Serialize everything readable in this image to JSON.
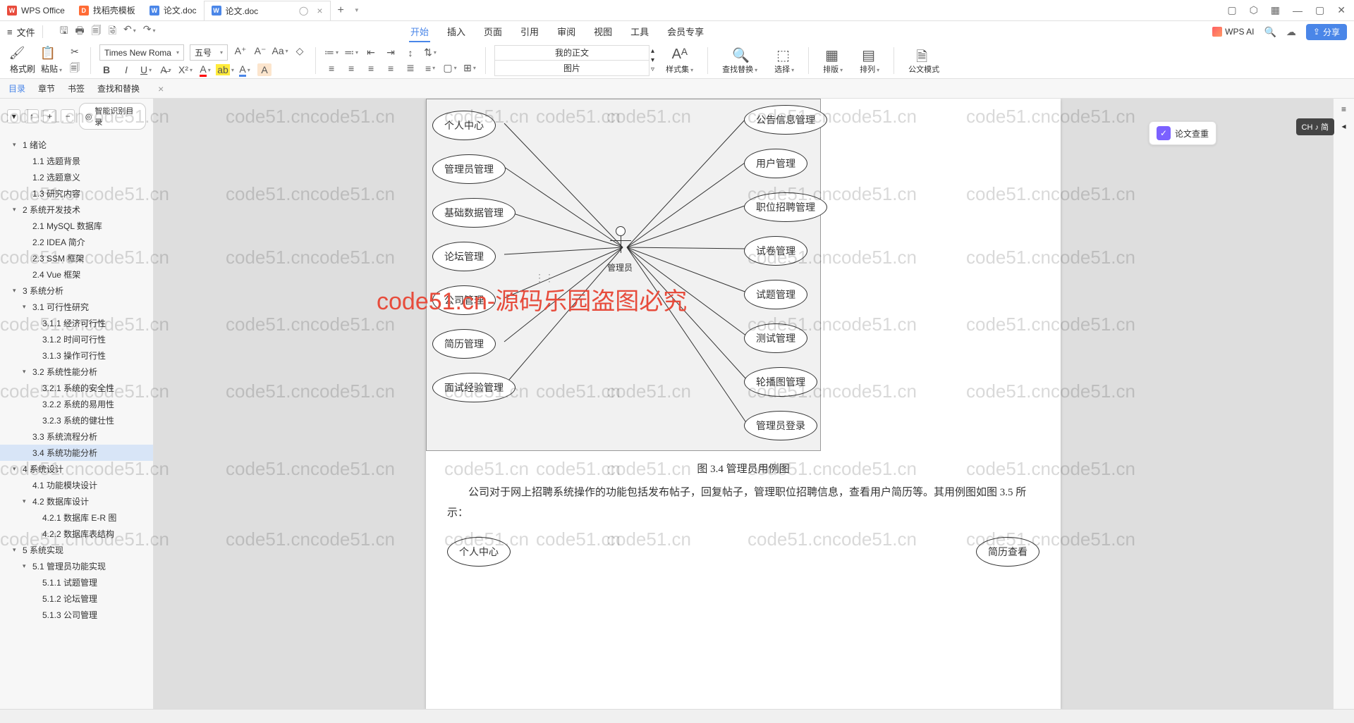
{
  "titlebar": {
    "app_name": "WPS Office",
    "tab_template": "找稻壳模板",
    "tab_doc1": "论文.doc",
    "tab_doc2": "论文.doc"
  },
  "menu": {
    "file": "文件",
    "tabs": [
      "开始",
      "插入",
      "页面",
      "引用",
      "审阅",
      "视图",
      "工具",
      "会员专享"
    ],
    "active_tab": 0,
    "wps_ai": "WPS AI",
    "share": "分享"
  },
  "ribbon": {
    "format_brush": "格式刷",
    "paste": "粘贴",
    "font_name": "Times New Roma",
    "font_size": "五号",
    "style1": "我的正文",
    "style2": "图片",
    "style_panel": "样式集",
    "find_replace": "查找替换",
    "select": "选择",
    "sort": "排版",
    "arrange": "排列",
    "official": "公文模式"
  },
  "nav": {
    "tabs": [
      "目录",
      "章节",
      "书签",
      "查找和替换"
    ],
    "smart_toc": "智能识别目录"
  },
  "toc": [
    {
      "level": 1,
      "label": "1 绪论",
      "expand": true
    },
    {
      "level": 2,
      "label": "1.1 选题背景"
    },
    {
      "level": 2,
      "label": "1.2 选题意义"
    },
    {
      "level": 2,
      "label": "1.3 研究内容"
    },
    {
      "level": 1,
      "label": "2 系统开发技术",
      "expand": true
    },
    {
      "level": 2,
      "label": "2.1 MySQL 数据库"
    },
    {
      "level": 2,
      "label": "2.2 IDEA 简介"
    },
    {
      "level": 2,
      "label": "2.3 SSM 框架"
    },
    {
      "level": 2,
      "label": "2.4 Vue 框架"
    },
    {
      "level": 1,
      "label": "3 系统分析",
      "expand": true
    },
    {
      "level": 2,
      "label": "3.1 可行性研究",
      "expand": true
    },
    {
      "level": 3,
      "label": "3.1.1 经济可行性"
    },
    {
      "level": 3,
      "label": "3.1.2 时间可行性"
    },
    {
      "level": 3,
      "label": "3.1.3 操作可行性"
    },
    {
      "level": 2,
      "label": "3.2 系统性能分析",
      "expand": true
    },
    {
      "level": 3,
      "label": "3.2.1 系统的安全性"
    },
    {
      "level": 3,
      "label": "3.2.2 系统的易用性"
    },
    {
      "level": 3,
      "label": "3.2.3 系统的健壮性"
    },
    {
      "level": 2,
      "label": "3.3 系统流程分析"
    },
    {
      "level": 2,
      "label": "3.4 系统功能分析",
      "active": true
    },
    {
      "level": 1,
      "label": "4 系统设计",
      "expand": true
    },
    {
      "level": 2,
      "label": "4.1 功能模块设计"
    },
    {
      "level": 2,
      "label": "4.2 数据库设计",
      "expand": true
    },
    {
      "level": 3,
      "label": "4.2.1 数据库 E-R 图"
    },
    {
      "level": 3,
      "label": "4.2.2 数据库表结构"
    },
    {
      "level": 1,
      "label": "5 系统实现",
      "expand": true
    },
    {
      "level": 2,
      "label": "5.1 管理员功能实现",
      "expand": true
    },
    {
      "level": 3,
      "label": "5.1.1 试题管理"
    },
    {
      "level": 3,
      "label": "5.1.2 论坛管理"
    },
    {
      "level": 3,
      "label": "5.1.3 公司管理"
    }
  ],
  "diagram": {
    "actor_label": "管理员",
    "left_bubbles": [
      "个人中心",
      "管理员管理",
      "基础数据管理",
      "论坛管理",
      "公司管理",
      "简历管理",
      "面试经验管理"
    ],
    "right_bubbles": [
      "公告信息管理",
      "用户管理",
      "职位招聘管理",
      "试卷管理",
      "试题管理",
      "测试管理",
      "轮播图管理",
      "管理员登录"
    ],
    "caption": "图 3.4 管理员用例图",
    "body_text": "公司对于网上招聘系统操作的功能包括发布帖子，回复帖子，管理职位招聘信息，查看用户简历等。其用例图如图 3.5 所示：",
    "bottom_left": "个人中心",
    "bottom_right": "简历查看"
  },
  "aux": {
    "check": "论文查重",
    "ime": "CH ♪ 简"
  },
  "watermark": "code51.cn",
  "big_red": "code51.cn-源码乐园盗图必究"
}
